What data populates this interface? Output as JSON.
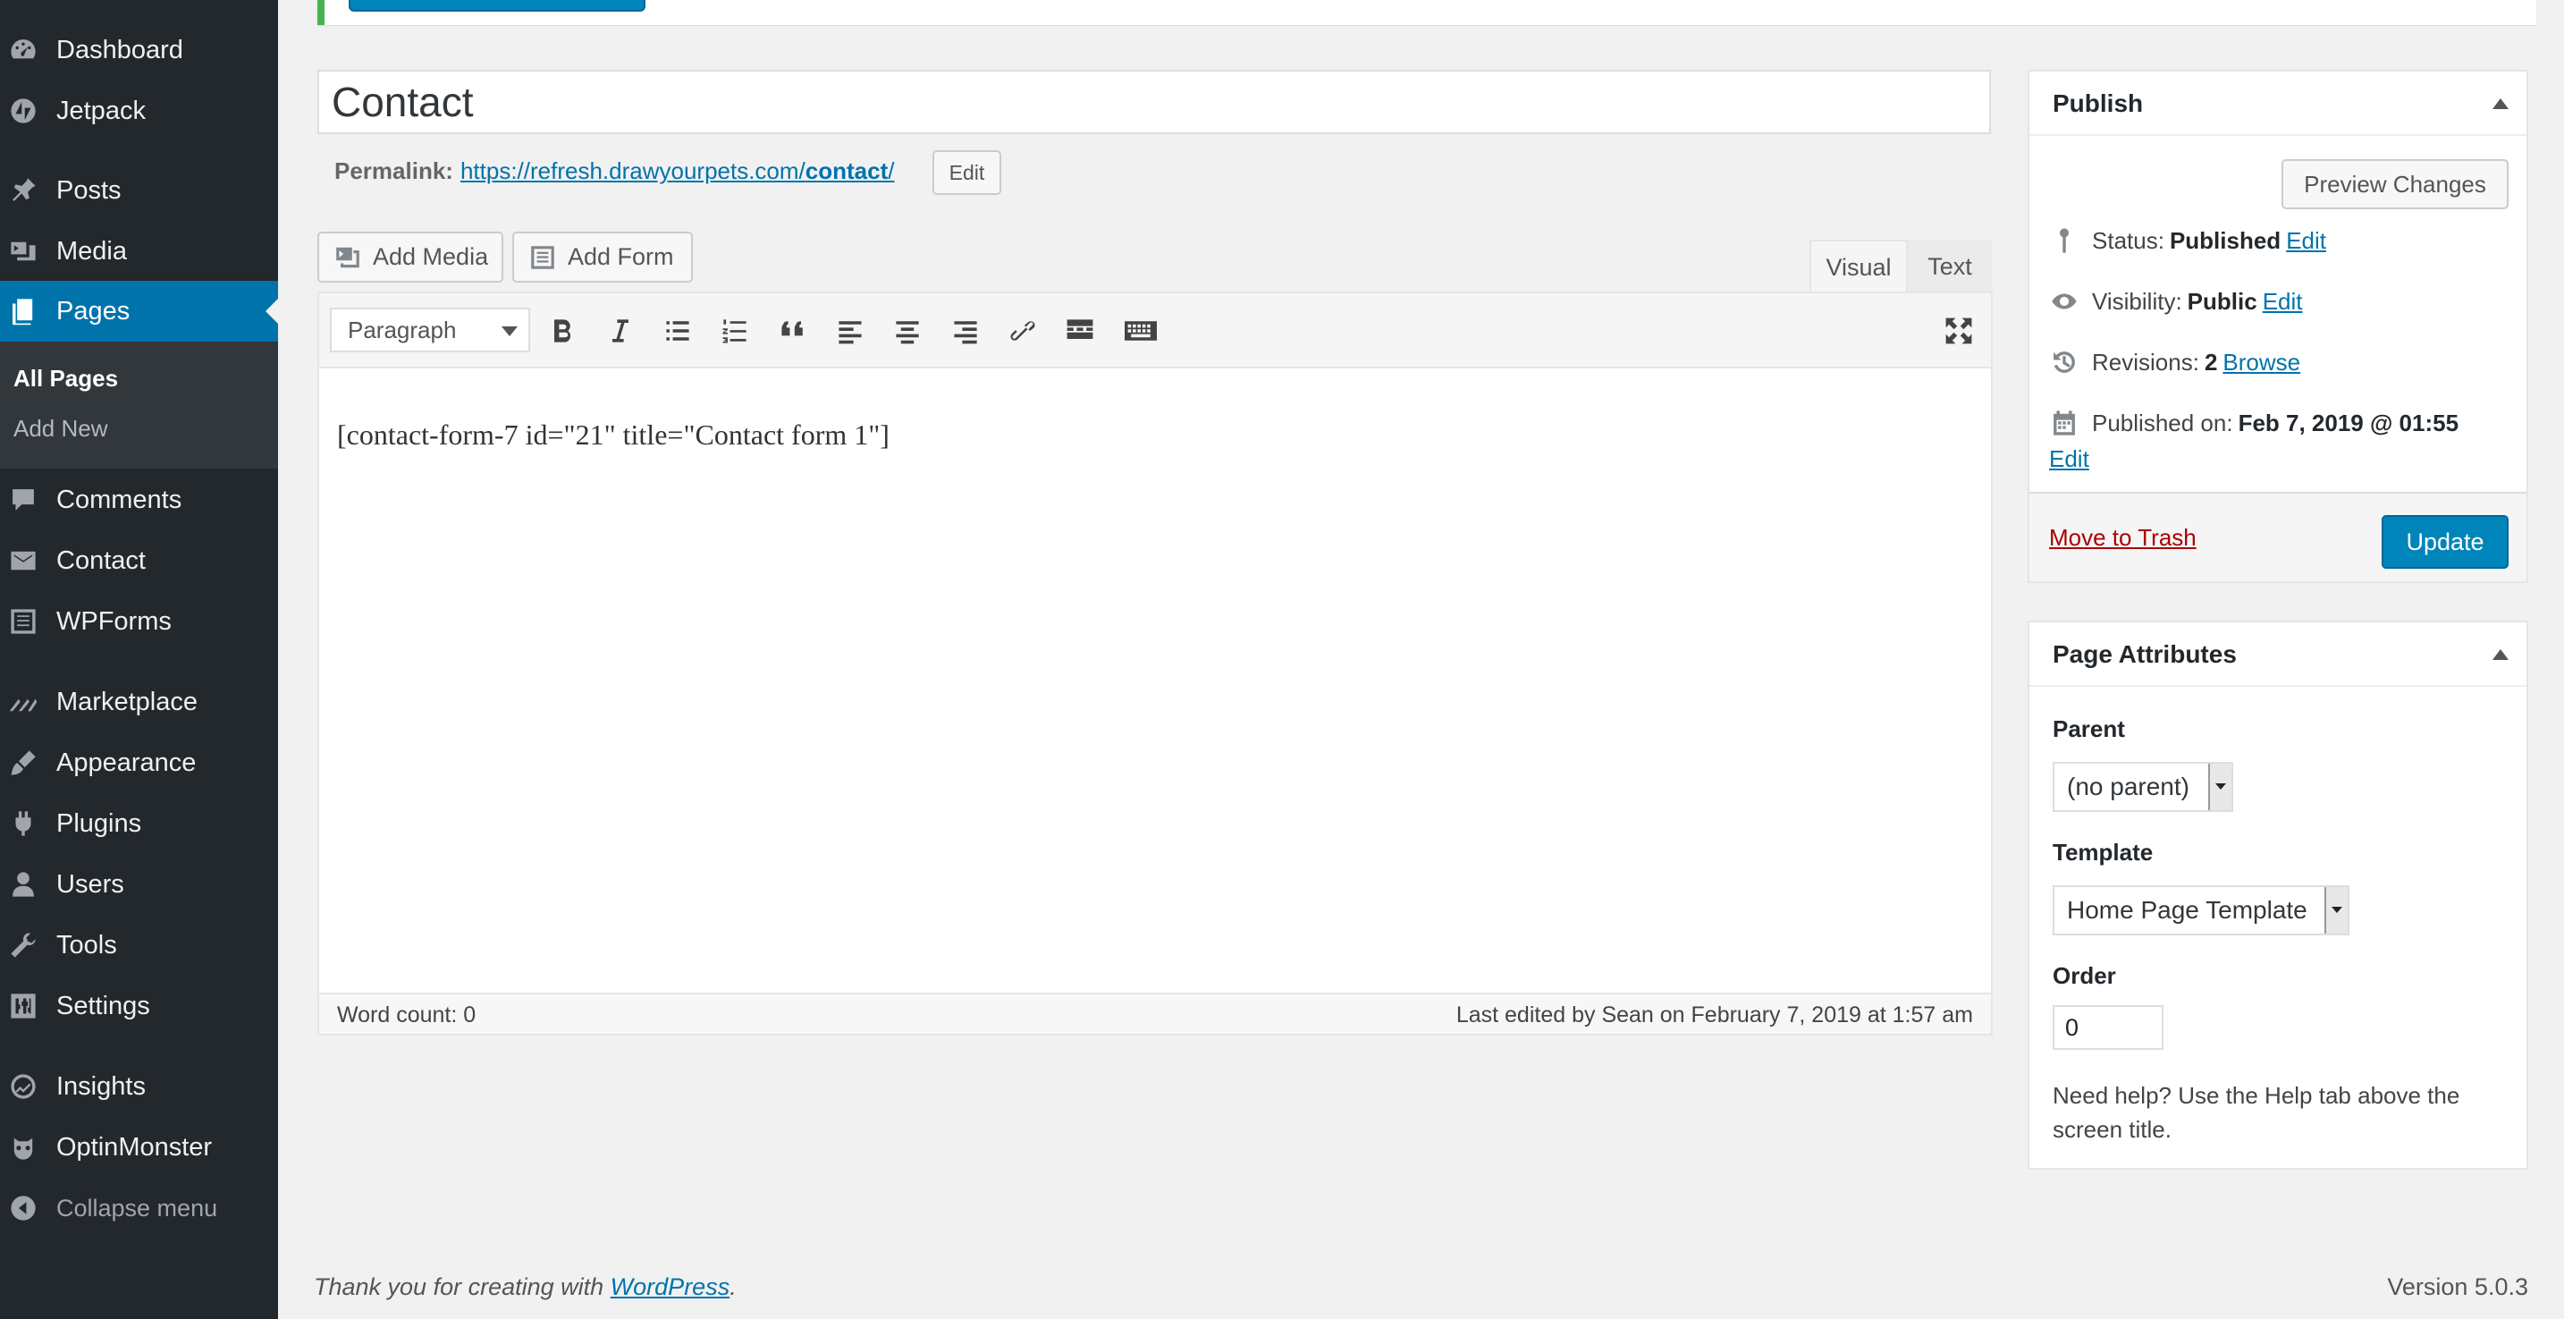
{
  "sidebar": {
    "items": [
      {
        "label": "Dashboard",
        "icon": "dashboard-icon"
      },
      {
        "label": "Jetpack",
        "icon": "jetpack-icon"
      },
      {
        "label": "Posts",
        "icon": "pin-icon"
      },
      {
        "label": "Media",
        "icon": "media-icon"
      },
      {
        "label": "Pages",
        "icon": "pages-icon"
      },
      {
        "label": "Comments",
        "icon": "comment-icon"
      },
      {
        "label": "Contact",
        "icon": "mail-icon"
      },
      {
        "label": "WPForms",
        "icon": "form-icon"
      },
      {
        "label": "Marketplace",
        "icon": "marketplace-icon"
      },
      {
        "label": "Appearance",
        "icon": "brush-icon"
      },
      {
        "label": "Plugins",
        "icon": "plugin-icon"
      },
      {
        "label": "Users",
        "icon": "user-icon"
      },
      {
        "label": "Tools",
        "icon": "wrench-icon"
      },
      {
        "label": "Settings",
        "icon": "settings-icon"
      },
      {
        "label": "Insights",
        "icon": "insights-icon"
      },
      {
        "label": "OptinMonster",
        "icon": "optinmonster-icon"
      },
      {
        "label": "Collapse menu",
        "icon": "collapse-icon"
      }
    ],
    "submenu": {
      "all_pages": "All Pages",
      "add_new": "Add New"
    }
  },
  "editor": {
    "title": "Contact",
    "permalink_label": "Permalink:",
    "permalink_base": "https://refresh.drawyourpets.com/",
    "permalink_slug": "contact",
    "permalink_trailing": "/",
    "permalink_edit": "Edit",
    "add_media": "Add Media",
    "add_form": "Add Form",
    "tab_visual": "Visual",
    "tab_text": "Text",
    "format": "Paragraph",
    "content": "[contact-form-7 id=\"21\" title=\"Contact form 1\"]",
    "word_count": "Word count: 0",
    "last_edited": "Last edited by Sean on February 7, 2019 at 1:57 am"
  },
  "publish": {
    "title": "Publish",
    "preview": "Preview Changes",
    "status_label": "Status:",
    "status_value": "Published",
    "visibility_label": "Visibility:",
    "visibility_value": "Public",
    "revisions_label": "Revisions:",
    "revisions_value": "2",
    "revisions_link": "Browse",
    "published_label": "Published on:",
    "published_value": "Feb 7, 2019 @ 01:55",
    "edit": "Edit",
    "trash": "Move to Trash",
    "update": "Update"
  },
  "attributes": {
    "title": "Page Attributes",
    "parent_label": "Parent",
    "parent_value": "(no parent)",
    "template_label": "Template",
    "template_value": "Home Page Template",
    "order_label": "Order",
    "order_value": "0",
    "help": "Need help? Use the Help tab above the screen title."
  },
  "footer": {
    "thanks_prefix": "Thank you for creating with ",
    "thanks_link": "WordPress",
    "thanks_suffix": ".",
    "version": "Version 5.0.3"
  },
  "colors": {
    "accent": "#0073aa",
    "sidebar": "#23282d",
    "notice": "#46b450",
    "trash": "#aa0000"
  }
}
